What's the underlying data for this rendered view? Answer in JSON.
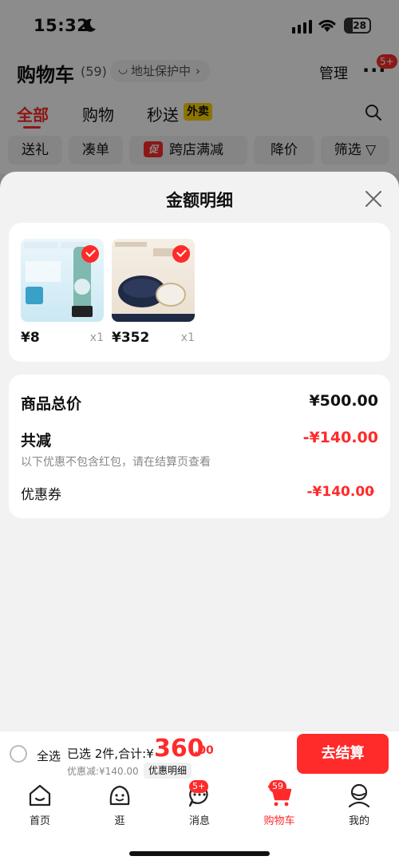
{
  "status_bar": {
    "time": "15:32",
    "battery": "28"
  },
  "header": {
    "title": "购物车",
    "count": "(59)",
    "address_label": "地址保护中",
    "manage_label": "管理",
    "more_badge": "5+"
  },
  "tabs": [
    {
      "label": "全部"
    },
    {
      "label": "购物"
    },
    {
      "label": "秒送"
    }
  ],
  "takeout_badge": "外卖",
  "filters": [
    {
      "label": "送礼"
    },
    {
      "label": "凑单"
    },
    {
      "label": "跨店满减",
      "tag": "促"
    },
    {
      "label": "降价"
    },
    {
      "label": "筛选"
    }
  ],
  "sheet": {
    "title": "金额明细",
    "items": [
      {
        "price": "¥8",
        "qty": "x1"
      },
      {
        "price": "¥352",
        "qty": "x1"
      }
    ],
    "summary": {
      "total_label": "商品总价",
      "total_value": "¥500.00",
      "reduce_label": "共减",
      "reduce_value": "-¥140.00",
      "note": "以下优惠不包含红包，请在结算页查看",
      "coupon_label": "优惠券",
      "coupon_value": "-¥140.00"
    }
  },
  "checkout": {
    "select_all": "全选",
    "selected_text": "已选 2件,合计:¥",
    "total_main": "360",
    "total_cents": ".00",
    "discount_text": "优惠减:¥140.00",
    "detail_label": "优惠明细",
    "button_label": "去结算"
  },
  "nav": [
    {
      "label": "首页",
      "icon": "home-icon"
    },
    {
      "label": "逛",
      "icon": "explore-icon"
    },
    {
      "label": "消息",
      "icon": "message-icon",
      "badge": "5+"
    },
    {
      "label": "购物车",
      "icon": "cart-icon",
      "badge": "59",
      "active": true
    },
    {
      "label": "我的",
      "icon": "profile-icon"
    }
  ],
  "colors": {
    "accent": "#ff2a2a",
    "badge_yellow": "#ffd400",
    "overlay": "rgba(0,0,0,0.45)"
  }
}
